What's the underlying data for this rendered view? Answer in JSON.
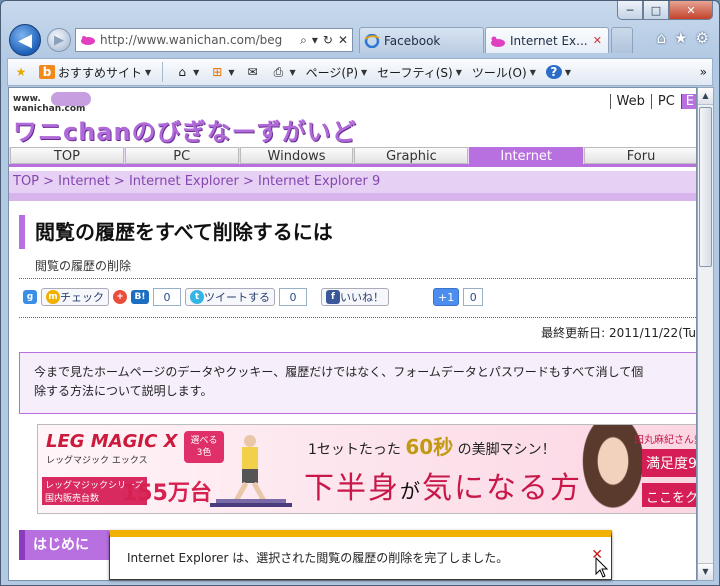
{
  "window": {
    "controls": {
      "minimize": "─",
      "maximize": "□",
      "close": "✕"
    }
  },
  "nav": {
    "back_icon": "◀",
    "forward_icon": "▶",
    "address": "http://www.wanichan.com/beg",
    "address_controls": [
      "⌕",
      "▾",
      "↻",
      "✕"
    ]
  },
  "tabs": [
    {
      "label": "Facebook",
      "active": false
    },
    {
      "label": "Internet Ex...",
      "active": true,
      "close": "✕"
    }
  ],
  "toolbar_icons": [
    "⌂",
    "★",
    "⚙"
  ],
  "command_bar": {
    "favorites_site": "おすすめサイト",
    "page": "ページ(P)",
    "safety": "セーフティ(S)",
    "tools": "ツール(O)"
  },
  "site": {
    "logo_small": "www.\nwanichan.com",
    "logo_main": "ワニchanのびぎなーずがいど",
    "top_links": [
      "Web",
      "PC",
      "E"
    ],
    "global_nav": [
      "TOP",
      "PC",
      "Windows",
      "Graphic",
      "Internet",
      "Foru"
    ],
    "active_nav": "Internet",
    "breadcrumb": "TOP > Internet > Internet Explorer > Internet Explorer 9"
  },
  "article": {
    "title": "閲覧の履歴をすべて削除するには",
    "subtitle": "閲覧の履歴の削除",
    "social": {
      "check_label": "チェック",
      "hatena_label": "B!",
      "hatena_count": "0",
      "tweet_label": "ツイートする",
      "tweet_count": "0",
      "like_label": "いいね！",
      "plus_label": "+1",
      "plus_count": "0"
    },
    "updated": "最終更新日: 2011/11/22(Tu",
    "intro": "今まで見たホームページのデータやクッキー、履歴だけではなく、フォームデータとパスワードもすべて消して個\n除する方法について説明します。",
    "section": "はじめに"
  },
  "banner": {
    "brand": "LEG MAGIC X",
    "brand_sub": "レッグマジック エックス",
    "badge": "選べる\n3色",
    "series": "レッグマジックシリーズ\n国内販売台数",
    "big": "155万台",
    "copy_pre": "1セットたった",
    "copy_highlight": "60秒",
    "copy_post": "の美脚マシン！",
    "headline_a": "下半身",
    "headline_b": "が",
    "headline_c": "気になる方",
    "right_1": "田丸麻紀さん愛用",
    "right_2": "満足度9",
    "right_3": "ここをク"
  },
  "notification": {
    "message": "Internet Explorer は、選択された閲覧の履歴の削除を完了しました。",
    "close": "✕"
  },
  "colors": {
    "accent": "#b86fe0",
    "notify_bar": "#f2b100"
  }
}
